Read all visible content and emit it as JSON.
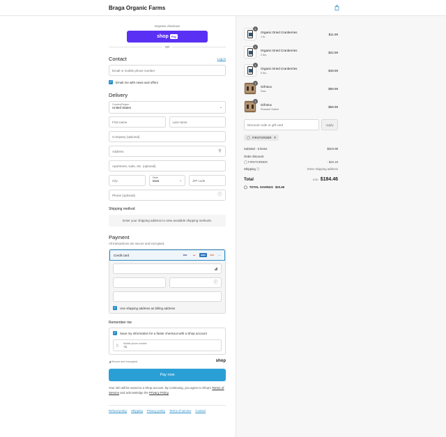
{
  "header": {
    "store_name": "Braga Organic Farms",
    "cart_icon": "shopping-bag-icon"
  },
  "express": {
    "label": "Express checkout",
    "shop_pay_text": "shop",
    "shop_pay_tag": "Pay",
    "or_label": "OR"
  },
  "contact": {
    "title": "Contact",
    "login_link": "Log in",
    "email_placeholder": "Email or mobile phone number",
    "news_label": "Email me with news and offers"
  },
  "delivery": {
    "title": "Delivery",
    "country_label": "Country/Region",
    "country_value": "United States",
    "first_name": "First name",
    "last_name": "Last name",
    "company": "Company (optional)",
    "address": "Address",
    "apartment": "Apartment, suite, etc. (optional)",
    "city": "City",
    "state_label": "State",
    "state_value": "Iowa",
    "zip": "ZIP code",
    "phone": "Phone (optional)"
  },
  "shipping": {
    "title": "Shipping method",
    "info": "Enter your shipping address to view available shipping methods."
  },
  "payment": {
    "title": "Payment",
    "subtitle": "All transactions are secure and encrypted.",
    "method_label": "Credit card",
    "logos": [
      "VISA",
      "MC",
      "AMEX",
      "DISC"
    ],
    "more_arrow": "→",
    "billing_label": "Use shipping address as billing address"
  },
  "remember": {
    "title": "Remember me",
    "save_label": "Save my information for a faster checkout with a Shop account",
    "phone_label": "Mobile phone number",
    "phone_value": "+1",
    "secure_label": "Secure and encrypted",
    "shop_label": "shop"
  },
  "pay_now": {
    "label": "Pay now",
    "disclaimer_1": "Your info will be saved to a Shop account. By continuing, you agree to Shop's",
    "terms": "Terms of Service",
    "disclaimer_2": " and acknowledge the ",
    "privacy": "Privacy Policy",
    "disclaimer_3": "."
  },
  "footer": {
    "links": [
      "Refund policy",
      "Shipping",
      "Privacy policy",
      "Terms of service",
      "Contact"
    ]
  },
  "cart": {
    "items": [
      {
        "qty": "1",
        "name": "Organic Dried Cranberries",
        "variant": "1 lb.",
        "price": "$11.99",
        "type": "jar"
      },
      {
        "qty": "1",
        "name": "Organic Dried Cranberries",
        "variant": "2 lbs.",
        "price": "$22.99",
        "type": "jar"
      },
      {
        "qty": "1",
        "name": "Organic Dried Cranberries",
        "variant": "5 lbs.",
        "price": "$49.99",
        "type": "jar"
      },
      {
        "qty": "1",
        "name": "Gift Box",
        "variant": "Raw",
        "price": "$59.99",
        "type": "box"
      },
      {
        "qty": "1",
        "name": "Gift Box",
        "variant": "Roasted Salted",
        "price": "$59.99",
        "type": "box"
      }
    ],
    "discount_placeholder": "Discount code or gift card",
    "apply_label": "Apply",
    "code_chip": "FIRSTORDER",
    "subtotal_label": "Subtotal · 5 items",
    "subtotal_value": "$204.95",
    "order_discount_label": "Order discount",
    "discount_code": "FIRSTORDER",
    "discount_value": "- $20.49",
    "shipping_label": "Shipping",
    "shipping_value": "Enter shipping address",
    "total_label": "Total",
    "currency": "USD",
    "total_value": "$184.46",
    "savings_label": "TOTAL SAVINGS",
    "savings_value": "$20.49"
  }
}
